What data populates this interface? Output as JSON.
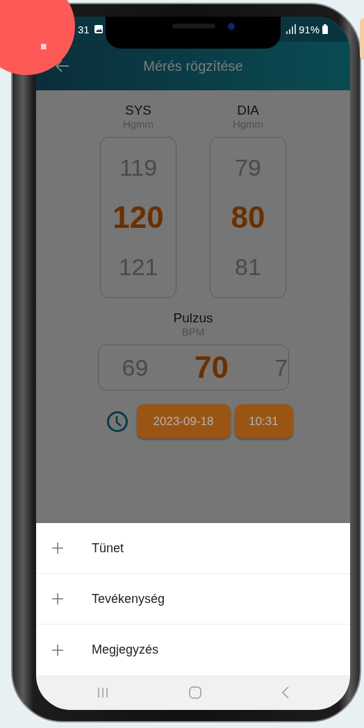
{
  "badge": {
    "text": "."
  },
  "status_bar": {
    "time": "31",
    "battery": "91%"
  },
  "app_bar": {
    "title": "Mérés rögzítése"
  },
  "pickers": [
    {
      "label": "SYS",
      "unit": "Hgmm",
      "values": [
        {
          "text": "119",
          "selected": false
        },
        {
          "text": "120",
          "selected": true
        },
        {
          "text": "121",
          "selected": false
        }
      ]
    },
    {
      "label": "DIA",
      "unit": "Hgmm",
      "values": [
        {
          "text": "79",
          "selected": false
        },
        {
          "text": "80",
          "selected": true
        },
        {
          "text": "81",
          "selected": false
        }
      ]
    }
  ],
  "pulse": {
    "label": "Pulzus",
    "unit": "BPM",
    "values": [
      {
        "text": "69",
        "selected": false
      },
      {
        "text": "70",
        "selected": true
      },
      {
        "text": "7",
        "selected": false
      }
    ]
  },
  "date_button": "2023-09-18",
  "time_button": "10:31",
  "sheet_items": [
    {
      "label": "Tünet"
    },
    {
      "label": "Tevékenység"
    },
    {
      "label": "Megjegyzés"
    }
  ]
}
